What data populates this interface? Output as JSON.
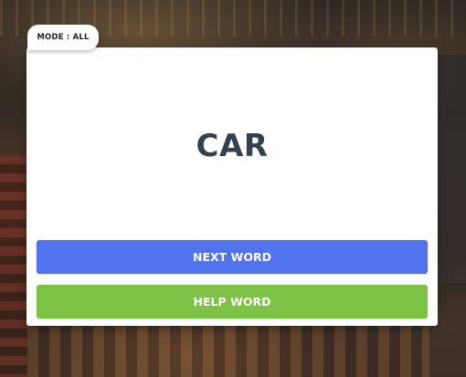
{
  "mode_tab": {
    "label": "MODE : ALL"
  },
  "card": {
    "word": "CAR",
    "next_button_label": "NEXT WORD",
    "help_button_label": "HELP WORD"
  },
  "colors": {
    "next_button": "#5173ee",
    "help_button": "#7cc245",
    "word_text": "#34404b"
  }
}
